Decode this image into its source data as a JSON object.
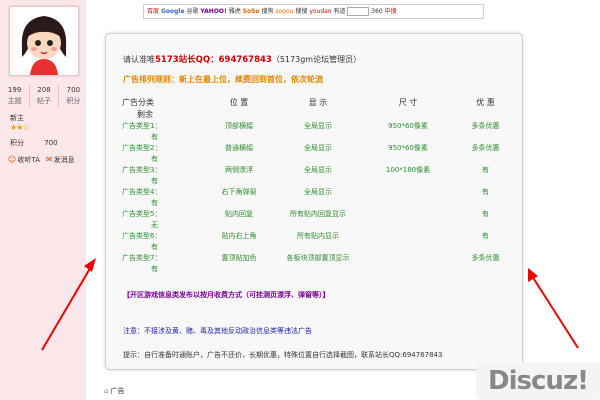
{
  "profile": {
    "stats": [
      {
        "value": "199",
        "label": "主题"
      },
      {
        "value": "208",
        "label": "帖子"
      },
      {
        "value": "700",
        "label": "积分"
      }
    ],
    "rank": "新主",
    "credits_label": "积分",
    "credits_value": "700",
    "follow_label": "收听TA",
    "message_label": "发消息"
  },
  "banner": {
    "items": [
      "百度",
      "Google",
      "谷歌",
      "YAHOO!",
      "雅虎",
      "SoSo",
      "搜狗",
      "sogou",
      "搜搜",
      "youdao",
      "有道",
      "360",
      "中搜"
    ]
  },
  "card": {
    "contact_prefix": "请认准唯",
    "contact_red": "5173站长QQ：694767843",
    "contact_suffix": "（5173gm论坛管理员）",
    "rule": "广告排列规则：新上在最上位，续费回到首位，依次轮流",
    "headers": [
      "广告分类",
      "位 置",
      "显 示",
      "尺 寸",
      "优 惠"
    ],
    "sub_header": "剩余",
    "rows": [
      {
        "cat": "广告类型1：",
        "pos": "顶部横幅",
        "show": "全局显示",
        "size": "950*60像素",
        "discount": "多条优惠",
        "remain": "有"
      },
      {
        "cat": "广告类型2：",
        "pos": "普通横幅",
        "show": "全局显示",
        "size": "950*60像素",
        "discount": "多条优惠",
        "remain": "有"
      },
      {
        "cat": "广告类型3：",
        "pos": "两侧漂浮",
        "show": "全局显示",
        "size": "100*180像素",
        "discount": "有",
        "remain": "有"
      },
      {
        "cat": "广告类型4：",
        "pos": "右下角弹窗",
        "show": "全局显示",
        "size": "",
        "discount": "有",
        "remain": "有"
      },
      {
        "cat": "广告类型5：",
        "pos": "贴内回复",
        "show": "所有贴内回复显示",
        "size": "",
        "discount": "有",
        "remain": "无"
      },
      {
        "cat": "广告类型6：",
        "pos": "贴内右上角",
        "show": "所有贴内显示",
        "size": "",
        "discount": "有",
        "remain": "有"
      },
      {
        "cat": "广告类型7：",
        "pos": "置顶贴加色",
        "show": "各板块顶部置顶显示",
        "size": "",
        "discount": "多条优惠",
        "remain": "有"
      }
    ],
    "purple_note": "【开区游戏信息类发布以按月收费方式（可挂测页漂浮、弹窗等）】",
    "blue_note": "注意：不接涉及黄、赌、毒及其他反动政治信息类等违法广告",
    "tip": "提示：自行准备时通账户，广告不还价，长期优惠，特殊位置自行选择截图，联系站长QQ:694767843"
  },
  "footer": {
    "tag_label": "广告"
  },
  "watermark": "Discuz!"
}
